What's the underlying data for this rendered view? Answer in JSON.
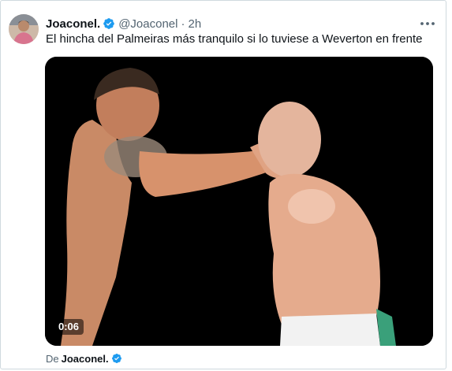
{
  "tweet": {
    "display_name": "Joaconel.",
    "handle": "@Joaconel",
    "separator": "·",
    "timestamp": "2h",
    "text": "El hincha del Palmeiras más tranquilo si lo tuviese a Weverton en frente",
    "verified": true
  },
  "media": {
    "type": "video",
    "duration": "0:06"
  },
  "attribution": {
    "prefix": "De",
    "name": "Joaconel."
  },
  "icons": {
    "more": "more-horizontal-icon",
    "verified": "verified-badge-icon"
  },
  "colors": {
    "verified_blue": "#1d9bf0",
    "secondary_text": "#536471",
    "primary_text": "#0f1419",
    "border": "#cfd9de"
  }
}
